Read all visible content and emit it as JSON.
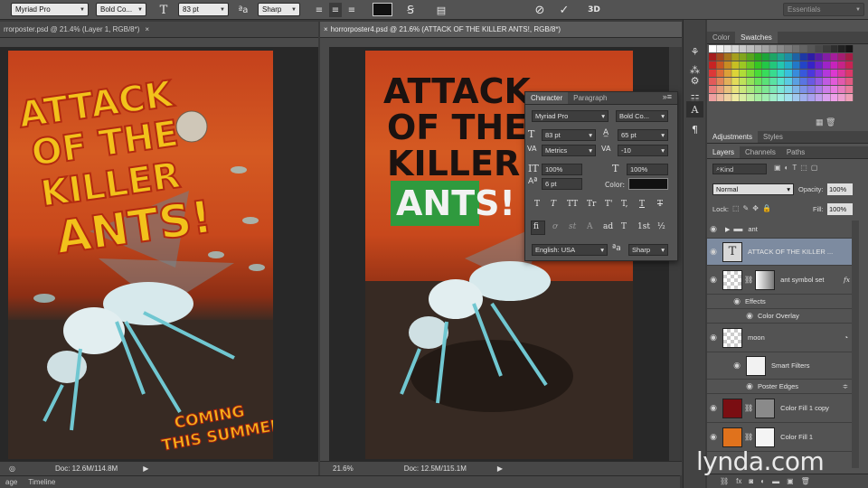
{
  "options_bar": {
    "font_family": "Myriad Pro",
    "font_style": "Bold Co...",
    "font_size": "83 pt",
    "aa_label": "a",
    "anti_alias": "Sharp",
    "workspace": "Essentials"
  },
  "doc_left": {
    "tab_title": "rrorposter.psd @ 21.4% (Layer 1, RGB/8*)",
    "zoom": "21.4%",
    "doc_size": "Doc: 12.6M/114.8M",
    "poster": {
      "title_lines": [
        "ATTACK",
        "OF THE",
        "KILLER",
        "ANTS!"
      ],
      "tagline_lines": [
        "COMING",
        "THIS SUMMER"
      ]
    }
  },
  "doc_right": {
    "tab_title": "horrorposter4.psd @ 21.6% (ATTACK OF THE KILLER ANTS!, RGB/8*)",
    "zoom": "21.6%",
    "doc_size": "Doc: 12.5M/115.1M",
    "poster": {
      "title_lines": [
        "ATTACK",
        "OF THE",
        "KILLER"
      ],
      "selected_word": "ANTS!"
    }
  },
  "character_panel": {
    "tabs": [
      "Character",
      "Paragraph"
    ],
    "font_family": "Myriad Pro",
    "font_style": "Bold Co...",
    "size": "83 pt",
    "leading": "65 pt",
    "kerning": "Metrics",
    "tracking": "-10",
    "vertical_scale": "100%",
    "horizontal_scale": "100%",
    "baseline_shift": "6 pt",
    "color_label": "Color:",
    "language": "English: USA",
    "aa_label": "a",
    "anti_alias": "Sharp",
    "type_buttons": [
      "T",
      "T",
      "TT",
      "Tr",
      "T'",
      "T,",
      "T",
      "T"
    ],
    "opentype_buttons": [
      "fi",
      "ơ",
      "st",
      "A",
      "ad",
      "T",
      "1st",
      "½"
    ]
  },
  "color_panel": {
    "tabs": [
      "Color",
      "Swatches"
    ],
    "active_tab": "Swatches"
  },
  "adjust_panel": {
    "tabs": [
      "Adjustments",
      "Styles"
    ]
  },
  "layers_panel": {
    "tabs": [
      "Layers",
      "Channels",
      "Paths"
    ],
    "filter_label": "Kind",
    "blend_mode": "Normal",
    "opacity_label": "Opacity:",
    "opacity": "100%",
    "lock_label": "Lock:",
    "fill_label": "Fill:",
    "fill": "100%",
    "layers": [
      {
        "name": "ant",
        "kind": "group"
      },
      {
        "name": "ATTACK OF THE KILLER ...",
        "kind": "text",
        "selected": true
      },
      {
        "name": "ant symbol set",
        "kind": "smart",
        "fx": "fx"
      },
      {
        "name": "Effects",
        "kind": "effects"
      },
      {
        "name": "Color Overlay",
        "kind": "effect"
      },
      {
        "name": "moon",
        "kind": "smart"
      },
      {
        "name": "Smart Filters",
        "kind": "filters"
      },
      {
        "name": "Poster Edges",
        "kind": "filter"
      },
      {
        "name": "Color Fill 1 copy",
        "kind": "fill",
        "color": "#7a0e12"
      },
      {
        "name": "Color Fill 1",
        "kind": "fill",
        "color": "#e0721c"
      }
    ]
  },
  "bottom_tabs": [
    "age",
    "Timeline"
  ],
  "watermark": "lynda.com",
  "colors": {
    "panel": "#535353",
    "dark": "#282828",
    "poster_orange": "#c8481c",
    "title_yellow": "#f2c21b",
    "title_red": "#b22a10",
    "selection_green": "#2f9a3e"
  }
}
